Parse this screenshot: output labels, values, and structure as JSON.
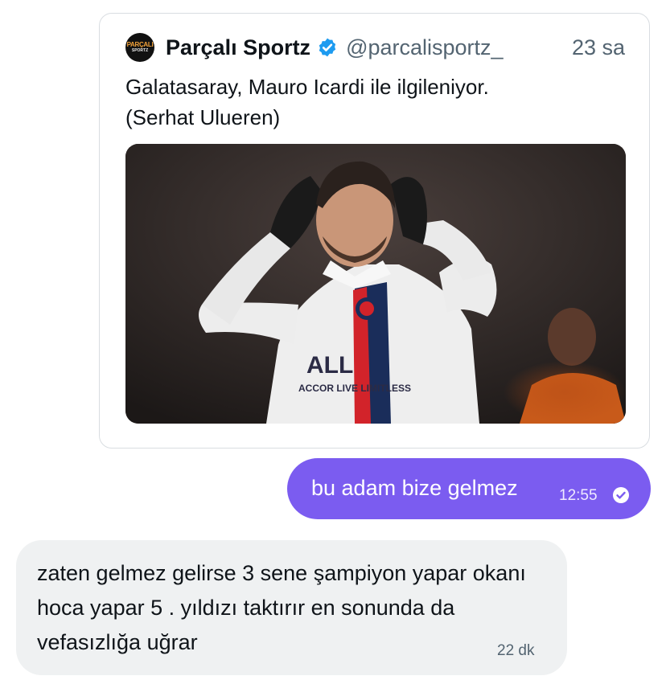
{
  "quoted_tweet": {
    "author_logo": {
      "line1": "PARÇALI",
      "line2": "SPORTZ"
    },
    "author_name": "Parçalı Sportz",
    "verified_icon": "verified-badge-icon",
    "handle": "@parcalisportz_",
    "time_ago": "23 sa",
    "text_line1": "Galatasaray, Mauro Icardi ile ilgileniyor.",
    "text_line2": "(Serhat Ulueren)",
    "media": {
      "description": "player in white PSG kit with hands on head",
      "jersey_text_1": "ALL",
      "jersey_text_2": "ACCOR LIVE LIMITLESS"
    }
  },
  "messages": [
    {
      "direction": "outgoing",
      "text": "bu adam bize gelmez",
      "time": "12:55",
      "status_icon": "read-check-icon"
    },
    {
      "direction": "incoming",
      "text": "zaten gelmez gelirse 3 sene şampiyon yapar okanı hoca yapar 5 . yıldızı taktırır en sonunda da vefasızlığa uğrar",
      "time": "22 dk"
    }
  ],
  "colors": {
    "outgoing_bubble": "#7b5cf0",
    "incoming_bubble": "#eff1f2",
    "verified_blue": "#1d9bf0",
    "text_primary": "#0f1419",
    "text_secondary": "#536471"
  }
}
